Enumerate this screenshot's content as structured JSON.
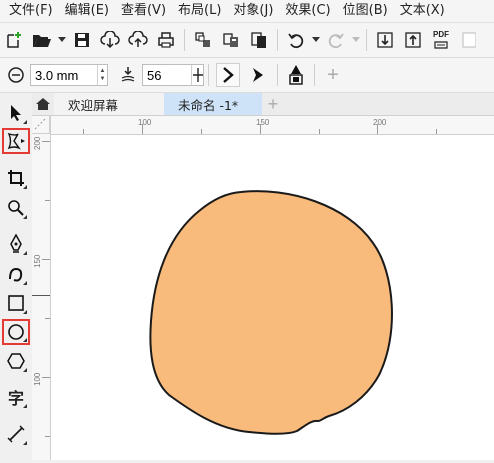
{
  "menu": {
    "items": [
      "文件(F)",
      "编辑(E)",
      "查看(V)",
      "布局(L)",
      "对象(J)",
      "效果(C)",
      "位图(B)",
      "文本(X)"
    ]
  },
  "toolbar": {
    "pdf_label": "PDF"
  },
  "propbar": {
    "outline_width": "3.0 mm",
    "nodes_value": "56",
    "add_label": "+"
  },
  "tabs": {
    "welcome": "欢迎屏幕",
    "document": "未命名 -1*",
    "add": "+"
  },
  "rulers": {
    "top": [
      "100",
      "150",
      "200"
    ],
    "left": [
      "200",
      "150",
      "100"
    ]
  },
  "toolbox": {
    "text_tool_glyph": "字"
  },
  "shape": {
    "fill": "#f8bb7c",
    "stroke": "#1a1a1a"
  },
  "colors": {
    "active_tool_border": "#e53935",
    "active_tab": "#cfe3f8"
  }
}
